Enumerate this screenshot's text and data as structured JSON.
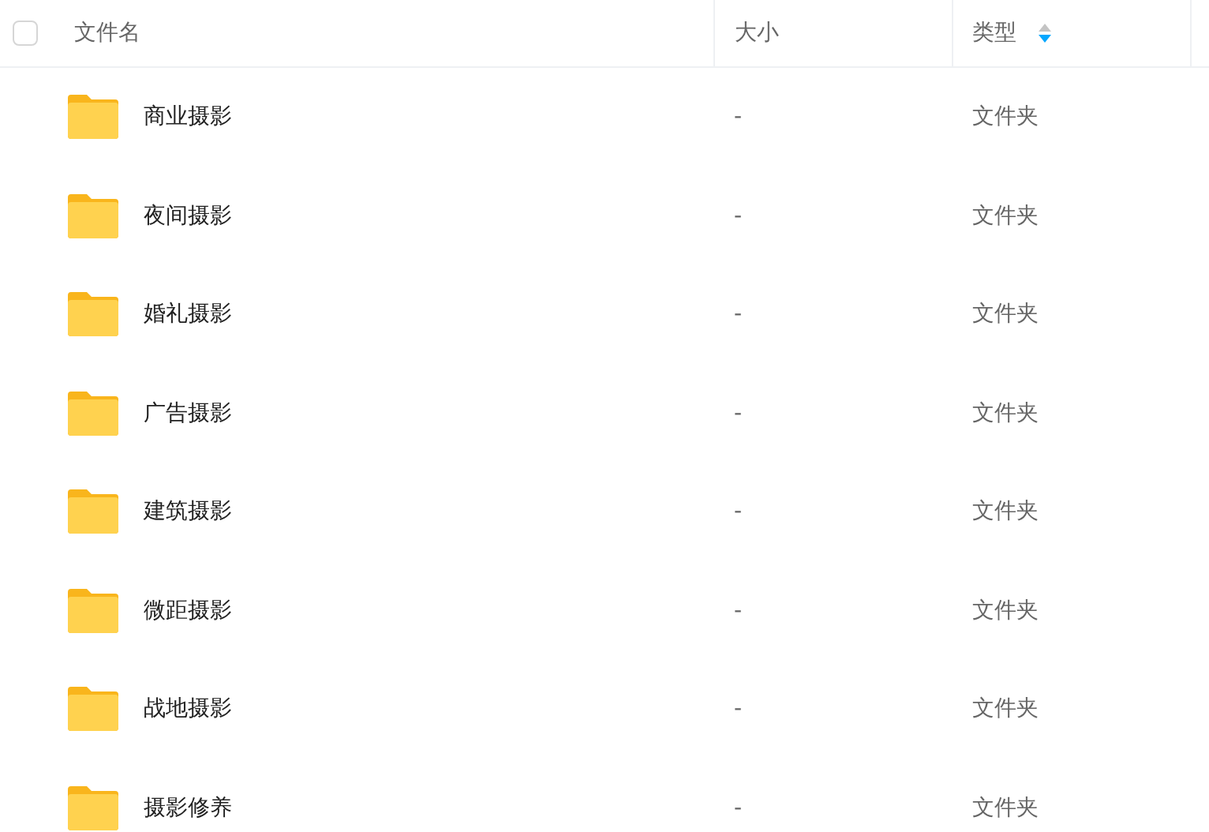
{
  "table": {
    "select_all": {
      "checked": false
    },
    "columns": [
      {
        "label": "文件名",
        "sorted": false
      },
      {
        "label": "大小",
        "sorted": false
      },
      {
        "label": "类型",
        "sorted": true
      }
    ],
    "rows": [
      {
        "name": "商业摄影",
        "size": "-",
        "type": "文件夹"
      },
      {
        "name": "夜间摄影",
        "size": "-",
        "type": "文件夹"
      },
      {
        "name": "婚礼摄影",
        "size": "-",
        "type": "文件夹"
      },
      {
        "name": "广告摄影",
        "size": "-",
        "type": "文件夹"
      },
      {
        "name": "建筑摄影",
        "size": "-",
        "type": "文件夹"
      },
      {
        "name": "微距摄影",
        "size": "-",
        "type": "文件夹"
      },
      {
        "name": "战地摄影",
        "size": "-",
        "type": "文件夹"
      },
      {
        "name": "摄影修养",
        "size": "-",
        "type": "文件夹"
      }
    ]
  }
}
